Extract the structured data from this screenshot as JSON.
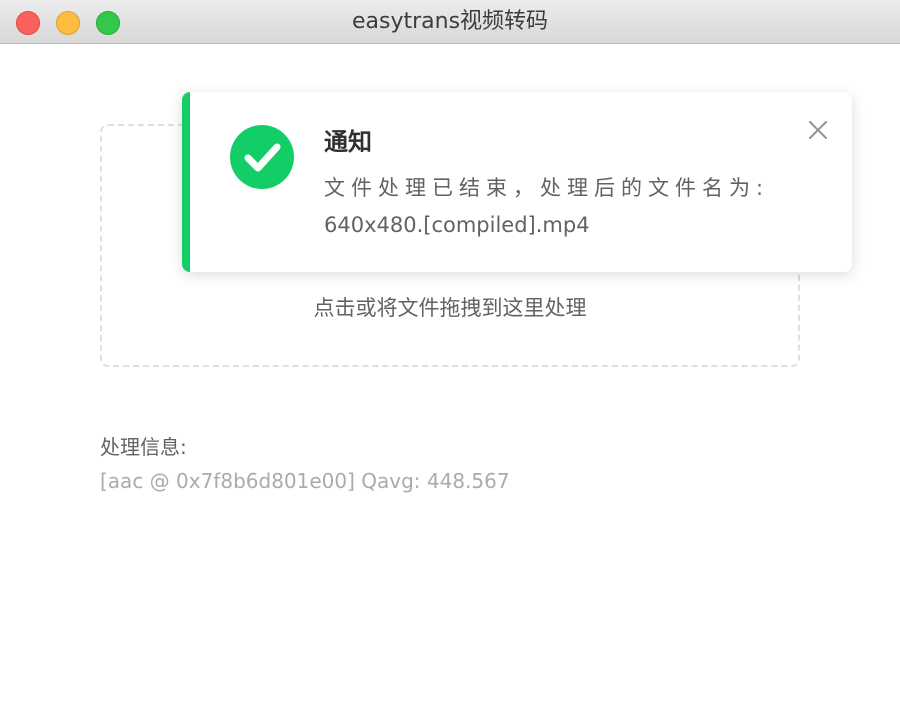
{
  "window": {
    "title": "easytrans视频转码"
  },
  "upload": {
    "prompt": "点击或将文件拖拽到这里处理"
  },
  "info": {
    "label": "处理信息:",
    "log": "[aac @ 0x7f8b6d801e00] Qavg: 448.567"
  },
  "notification": {
    "type": "success",
    "icon": "check-circle-icon",
    "title": "通知",
    "message": "文件处理已结束，处理后的文件名为:",
    "filename": "640x480.[compiled].mp4",
    "accent_color": "#13ce66"
  }
}
